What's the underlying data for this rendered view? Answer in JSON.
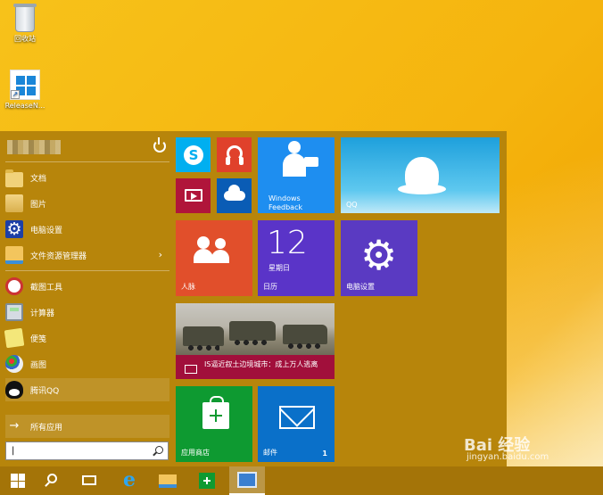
{
  "desktop": {
    "recycle_bin_label": "回收站",
    "release_notes_label": "ReleaseN..."
  },
  "start_menu": {
    "items": [
      {
        "label": "文档"
      },
      {
        "label": "图片"
      },
      {
        "label": "电脑设置"
      },
      {
        "label": "文件资源管理器"
      },
      {
        "label": "截图工具"
      },
      {
        "label": "计算器"
      },
      {
        "label": "便笺"
      },
      {
        "label": "画图"
      },
      {
        "label": "腾讯QQ"
      }
    ],
    "all_apps_label": "所有应用",
    "search_value": "|",
    "tiles": {
      "feedback_label": "Windows Feedback",
      "qq_label": "QQ",
      "people_label": "人脉",
      "calendar_day": "12",
      "calendar_weekday": "星期日",
      "calendar_label": "日历",
      "settings_label": "电脑设置",
      "news_headline": "IS逼近叙土边境城市：成上万人逃离",
      "store_label": "应用商店",
      "mail_label": "邮件",
      "mail_count": "1"
    }
  },
  "watermark": {
    "brand": "Bai 经验",
    "url": "jingyan.baidu.com"
  }
}
